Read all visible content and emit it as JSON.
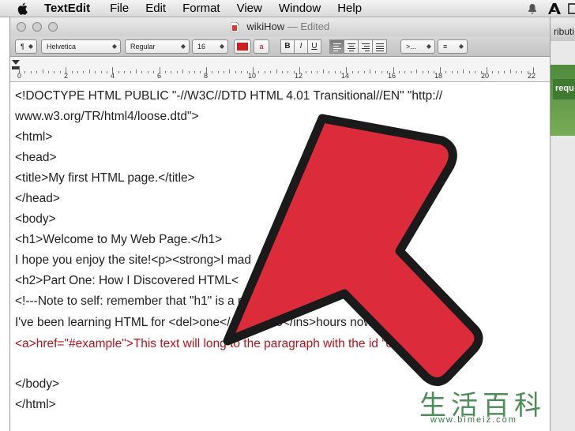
{
  "menubar": {
    "app_name": "TextEdit",
    "items": [
      "File",
      "Edit",
      "Format",
      "View",
      "Window",
      "Help"
    ]
  },
  "background_window": {
    "title_fragment": "ributi",
    "button_fragment": "requ"
  },
  "window": {
    "title": "wikiHow",
    "status": "— Edited"
  },
  "toolbar": {
    "paragraph_menu": "¶",
    "font_family": "Helvetica",
    "font_style": "Regular",
    "font_size": "16",
    "text_color": "#cc1f1f",
    "highlight_label": "a",
    "bold_label": "B",
    "italic_label": "I",
    "underline_label": "U",
    "spacing_label": ">...",
    "list_label": "≡"
  },
  "ruler": {
    "labels": [
      "0",
      "2",
      "4",
      "6",
      "8",
      "10",
      "12",
      "14",
      "16",
      "18",
      "20",
      "22"
    ]
  },
  "document": {
    "lines": [
      {
        "text": "<!DOCTYPE HTML PUBLIC \"-//W3C//DTD HTML 4.01 Transitional//EN\" \"http://",
        "style": "normal"
      },
      {
        "text": "       www.w3.org/TR/html4/loose.dtd\">",
        "style": "normal"
      },
      {
        "text": "<html>",
        "style": "normal"
      },
      {
        "text": "<head>",
        "style": "normal"
      },
      {
        "text": "<title>My first HTML page.</title>",
        "style": "normal"
      },
      {
        "text": "</head>",
        "style": "normal"
      },
      {
        "text": "<body>",
        "style": "normal"
      },
      {
        "text": "<h1>Welcome to My Web Page.</h1>",
        "style": "normal"
      },
      {
        "text": "I hope you enjoy the site!<p><strong>I mad",
        "style": "normal"
      },
      {
        "text": "<h2>Part One: How I Discovered HTML<",
        "style": "normal"
      },
      {
        "text": "<!---Note to self: remember that \"h1\" is a                  r than \"h2\"--->",
        "style": "normal"
      },
      {
        "text": "I've been learning HTML for <del>one</        <ins>two</ins>hours now, so I'm an expert.",
        "style": "normal"
      },
      {
        "text": "<a>href=\"#example\">This text will long to the paragraph with the id “example.”</a>",
        "style": "red"
      },
      {
        "text": "",
        "style": "normal"
      },
      {
        "text": "</body>",
        "style": "normal"
      },
      {
        "text": "</html>",
        "style": "normal"
      }
    ]
  },
  "overlay": {
    "arrow_color": "#dc2c3b",
    "arrow_outline": "#1a1a1a"
  },
  "watermark": {
    "chinese": "生活百科",
    "url": "www.bimeiz.com"
  }
}
